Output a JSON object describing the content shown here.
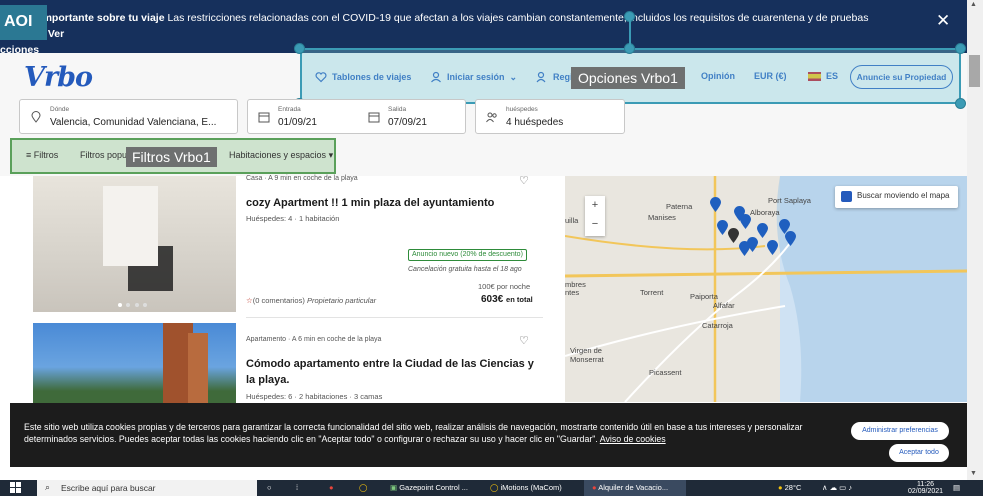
{
  "banner": {
    "bold_prefix": "mación importante sobre tu viaje",
    "text": " Las restricciones relacionadas con el COVID-19 que afectan a los viajes cambian constantemente, incluidos los requisitos de cuarentena y de pruebas médicas.",
    "link": "Ver",
    "line2": "cciones",
    "close": "✕"
  },
  "overlay": {
    "aoi": "AOI",
    "opciones": "Opciones Vrbo1",
    "filtros": "Filtros Vrbo1"
  },
  "header": {
    "logo": "Vrbo",
    "nav": {
      "tablones": "Tablones de viajes",
      "login": "Iniciar sesión",
      "register": "Regis",
      "opinion": "Opinión",
      "currency": "EUR (€)",
      "lang": "ES",
      "cta": "Anuncie su Propiedad"
    }
  },
  "search": {
    "where_label": "Dónde",
    "where_value": "Valencia, Comunidad Valenciana, E...",
    "in_label": "Entrada",
    "in_value": "01/09/21",
    "out_label": "Salida",
    "out_value": "07/09/21",
    "guests_label": "huéspedes",
    "guests_value": "4 huéspedes"
  },
  "filters": {
    "filtros": "Filtros",
    "popular": "Filtros popu",
    "rooms": "Habitaciones y espacios"
  },
  "listings": [
    {
      "tag": "Casa · A 9 min en coche de la playa",
      "title": "cozy Apartment !! 1 min plaza del ayuntamiento",
      "details": "Huéspedes: 4 · 1 habitación",
      "badge": "Anuncio nuevo (20% de descuento)",
      "cancel": "Cancelación gratuita hasta el 18 ago",
      "per_night": "100€ por noche",
      "total": "603€",
      "total_label": "en total",
      "reviews": "(0 comentarios)",
      "owner": "Propietario particular"
    },
    {
      "tag": "Apartamento · A 6 min en coche de la playa",
      "title": "Cómodo apartamento entre la Ciudad de las Ciencias y la playa.",
      "details": "Huéspedes: 6 · 2 habitaciones · 3 camas"
    }
  ],
  "map": {
    "check": "Buscar moviendo el mapa",
    "zoom_in": "+",
    "zoom_out": "−",
    "labels": {
      "paterna": "Paterna",
      "manises": "Manises",
      "alboraya": "Alboraya",
      "port": "Port Saplaya",
      "torrent": "Torrent",
      "paiporta": "Paiporta",
      "alfafar": "Alfafar",
      "catarroja": "Catarroja",
      "virgen": "Virgen de Monserrat",
      "picassent": "Picassent",
      "mbres": "mbres",
      "ntes": "ntes",
      "uilla": "uilla"
    }
  },
  "cookie": {
    "text": "Este sitio web utiliza cookies propias y de terceros para garantizar la correcta funcionalidad del sitio web, realizar análisis de navegación, mostrarte contenido útil en base a tus intereses y personalizar determinados servicios. Puedes aceptar todas las cookies haciendo clic en \"Aceptar todo\" o configurar o rechazar su uso y hacer clic en \"Guardar\". ",
    "link": "Aviso de cookies",
    "manage": "Administrar preferencias",
    "accept": "Aceptar todo"
  },
  "taskbar": {
    "search": "Escribe aquí para buscar",
    "app1": "Gazepoint Control ...",
    "app2": "iMotions (MaCom)",
    "app3": "Alquiler de Vacacio...",
    "temp": "28°C",
    "time": "11:26",
    "date": "02/09/2021"
  },
  "colors": {
    "brand": "#245abc",
    "banner": "#16305c",
    "aoi_blue": "#3b9bb5",
    "aoi_green": "#5aa05a",
    "pin": "#1f5fbf"
  }
}
